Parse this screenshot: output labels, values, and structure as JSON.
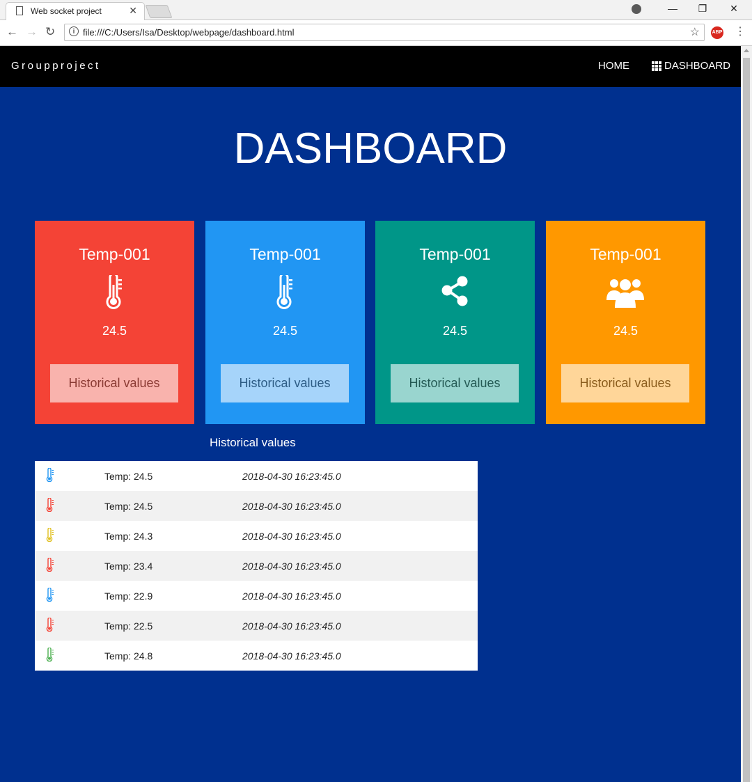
{
  "browser": {
    "tab_title": "Web socket project",
    "tab_close": "✕",
    "url": "file:///C:/Users/Isa/Desktop/webpage/dashboard.html",
    "abp_label": "ABP"
  },
  "navbar": {
    "brand": "Groupproject",
    "home": "HOME",
    "dashboard": "DASHBOARD"
  },
  "page": {
    "title": "DASHBOARD"
  },
  "cards": [
    {
      "title": "Temp-001",
      "icon": "thermometer-icon",
      "value": "24.5",
      "button": "Historical values",
      "color": "#f44336",
      "button_bg": "#f9b3ad",
      "button_text": "#8a3a33"
    },
    {
      "title": "Temp-001",
      "icon": "thermometer-icon",
      "value": "24.5",
      "button": "Historical values",
      "color": "#2196f3",
      "button_bg": "#a6d4fa",
      "button_text": "#2d5c85"
    },
    {
      "title": "Temp-001",
      "icon": "share-icon",
      "value": "24.5",
      "button": "Historical values",
      "color": "#009688",
      "button_bg": "#99d5cf",
      "button_text": "#245a54"
    },
    {
      "title": "Temp-001",
      "icon": "users-icon",
      "value": "24.5",
      "button": "Historical values",
      "color": "#ff9800",
      "button_bg": "#ffd699",
      "button_text": "#8a5c1c"
    }
  ],
  "history": {
    "heading": "Historical values",
    "rows": [
      {
        "icon_color": "#2196f3",
        "value": "Temp: 24.5",
        "timestamp": "2018-04-30 16:23:45.0"
      },
      {
        "icon_color": "#f44336",
        "value": "Temp: 24.5",
        "timestamp": "2018-04-30 16:23:45.0"
      },
      {
        "icon_color": "#e0c020",
        "value": "Temp: 24.3",
        "timestamp": "2018-04-30 16:23:45.0"
      },
      {
        "icon_color": "#f44336",
        "value": "Temp: 23.4",
        "timestamp": "2018-04-30 16:23:45.0"
      },
      {
        "icon_color": "#2196f3",
        "value": "Temp: 22.9",
        "timestamp": "2018-04-30 16:23:45.0"
      },
      {
        "icon_color": "#f44336",
        "value": "Temp: 22.5",
        "timestamp": "2018-04-30 16:23:45.0"
      },
      {
        "icon_color": "#4caf50",
        "value": "Temp: 24.8",
        "timestamp": "2018-04-30 16:23:45.0"
      }
    ]
  }
}
